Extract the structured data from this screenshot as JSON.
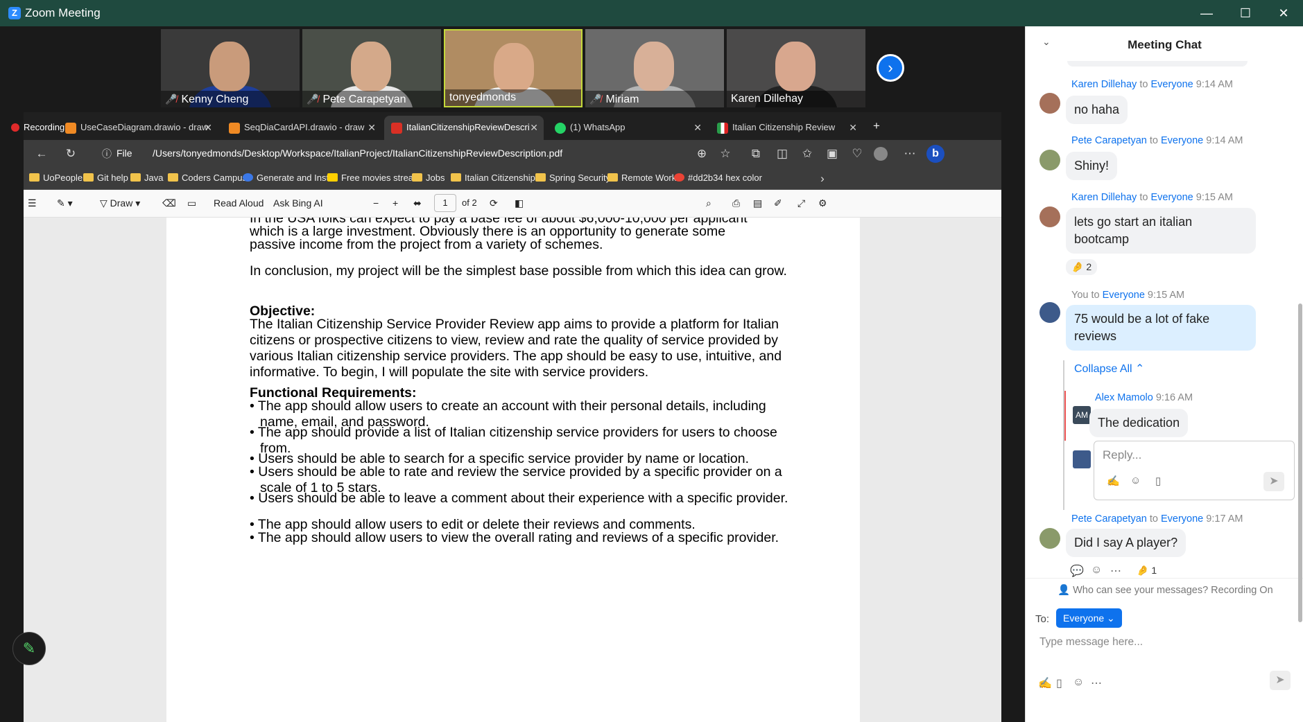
{
  "window": {
    "title": "Zoom Meeting",
    "minimize": "—",
    "maximize": "☐",
    "close": "✕"
  },
  "participants": [
    {
      "name": "Kenny Cheng",
      "muted": true
    },
    {
      "name": "Pete Carapetyan",
      "muted": true
    },
    {
      "name": "tonyedmonds",
      "muted": false
    },
    {
      "name": "Miriam",
      "muted": true
    },
    {
      "name": "Karen Dillehay",
      "muted": false
    }
  ],
  "recording": {
    "label": "Recording"
  },
  "browser": {
    "tabs": [
      {
        "label": "UseCaseDiagram.drawio - draw",
        "close": "✕"
      },
      {
        "label": "SeqDiaCardAPI.drawio - draw",
        "close": "✕"
      },
      {
        "label": "ItalianCitizenshipReviewDescri",
        "close": "✕"
      },
      {
        "label": "(1) WhatsApp",
        "close": "✕"
      },
      {
        "label": "Italian Citizenship Review",
        "close": "✕"
      }
    ],
    "new_tab": "+",
    "address": {
      "scheme": "File",
      "url": "/Users/tonyedmonds/Desktop/Workspace/ItalianProject/ItalianCitizenshipReviewDescription.pdf"
    },
    "bookmarks": [
      "UoPeople",
      "Git help",
      "Java",
      "Coders Campus",
      "Generate and Inst...",
      "Free movies strea...",
      "Jobs",
      "Italian Citizenship...",
      "Spring Security",
      "Remote Work",
      "#dd2b34 hex color"
    ],
    "pdf_toolbar": {
      "draw": "Draw",
      "read_aloud": "Read Aloud",
      "ask_bing": "Ask Bing AI",
      "page_current": "1",
      "page_total": "of 2"
    }
  },
  "document": {
    "line1": "In the USA folks can expect to pay a base fee of about $6,000-10,000 per applicant",
    "line2": "which is a large investment. Obviously there is an opportunity to generate some",
    "line3": "passive income from the project from a variety of schemes.",
    "conclusion": "In conclusion, my project will be the simplest base possible from which this idea can grow.",
    "objective_heading": "Objective:",
    "objective_text": "The Italian Citizenship Service Provider Review app aims to provide a platform for Italian citizens or prospective citizens to view, review and rate the quality of service provided by various Italian citizenship service providers. The app should be easy to use, intuitive, and informative. To begin, I will populate the site with service providers.",
    "func_heading": "Functional Requirements:",
    "requirements": [
      "The app should allow users to create an account with their personal details, including name, email, and password.",
      "The app should provide a list of Italian citizenship service providers for users to choose from.",
      "Users should be able to search for a specific service provider by name or location.",
      "Users should be able to rate and review the service provided by a specific provider on a scale of 1 to 5 stars.",
      "Users should be able to leave a comment about their experience with a specific provider.",
      "The app should allow users to edit or delete their reviews and comments.",
      "The app should allow users to view the overall rating and reviews of a specific provider."
    ]
  },
  "chat": {
    "title": "Meeting Chat",
    "to_word": "to",
    "messages": [
      {
        "sender": "Karen Dillehay",
        "to": "Everyone",
        "time": "9:14 AM",
        "text": "no haha"
      },
      {
        "sender": "Pete Carapetyan",
        "to": "Everyone",
        "time": "9:14 AM",
        "text": "Shiny!"
      },
      {
        "sender": "Karen Dillehay",
        "to": "Everyone",
        "time": "9:15 AM",
        "text": "lets go start an italian bootcamp",
        "reaction": "🤌 2"
      },
      {
        "sender": "You",
        "to": "Everyone",
        "time": "9:15 AM",
        "text": "75 would be a lot of fake reviews"
      },
      {
        "sender": "Pete Carapetyan",
        "to": "Everyone",
        "time": "9:17 AM",
        "text": "Did I say A player?",
        "reaction": "🤌 1"
      }
    ],
    "thread": {
      "collapse_label": "Collapse All",
      "reply": {
        "sender": "Alex Mamolo",
        "initials": "AM",
        "time": "9:16 AM",
        "text": "The dedication"
      },
      "reply_placeholder": "Reply..."
    },
    "privacy_note": "Who can see your messages? Recording On",
    "to_label": "To:",
    "recipient": "Everyone",
    "input_placeholder": "Type message here...",
    "colors": {
      "accent": "#0e72ed",
      "titlebar": "#1f4a3f"
    }
  }
}
